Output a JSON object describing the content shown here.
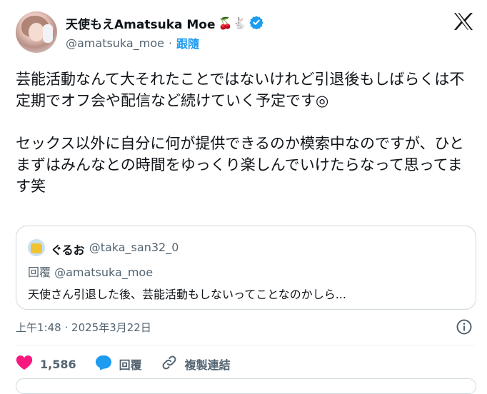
{
  "author": {
    "display_name": "天使もえAmatsuka Moe",
    "name_emojis": "🍒🐇",
    "handle": "@amatsuka_moe",
    "separator": "·",
    "follow_label": "跟隨"
  },
  "tweet": {
    "text": "芸能活動なんて大それたことではないけれど引退後もしばらくは不定期でオフ会や配信など続けていく予定です◎\n\nセックス以外に自分に何が提供できるのか模索中なのですが、ひとまずはみんなとの時間をゆっくり楽しんでいけたらなって思ってます笑",
    "time": "上午1:48",
    "date_separator": "·",
    "date": "2025年3月22日"
  },
  "quoted": {
    "name": "ぐるお",
    "handle": "@taka_san32_0",
    "reply_prefix": "回覆",
    "reply_to": "@amatsuka_moe",
    "text": "天使さん引退した後、芸能活動もしないってことなのかしら..."
  },
  "actions": {
    "like_count": "1,586",
    "reply_label": "回覆",
    "copy_link_label": "複製連結"
  },
  "colors": {
    "accent": "#1d9bf0",
    "like": "#f91880",
    "secondary_text": "#536471"
  }
}
